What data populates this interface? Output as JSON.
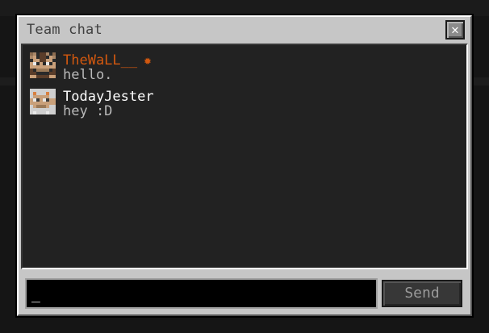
{
  "window": {
    "title": "Team chat",
    "close_glyph": "✕"
  },
  "messages": [
    {
      "author": "TheWaLL__",
      "text": "hello.",
      "name_color": "#d2580f",
      "badge": "star-icon",
      "badge_glyph": "✹",
      "avatar": "skin-thewall"
    },
    {
      "author": "TodayJester",
      "text": "hey :D",
      "name_color": "#ffffff",
      "avatar": "skin-todayjester"
    }
  ],
  "composer": {
    "value": "_",
    "send_label": "Send"
  },
  "colors": {
    "accent": "#d2580f",
    "panel": "#c6c6c6",
    "chat_bg": "#222222"
  }
}
